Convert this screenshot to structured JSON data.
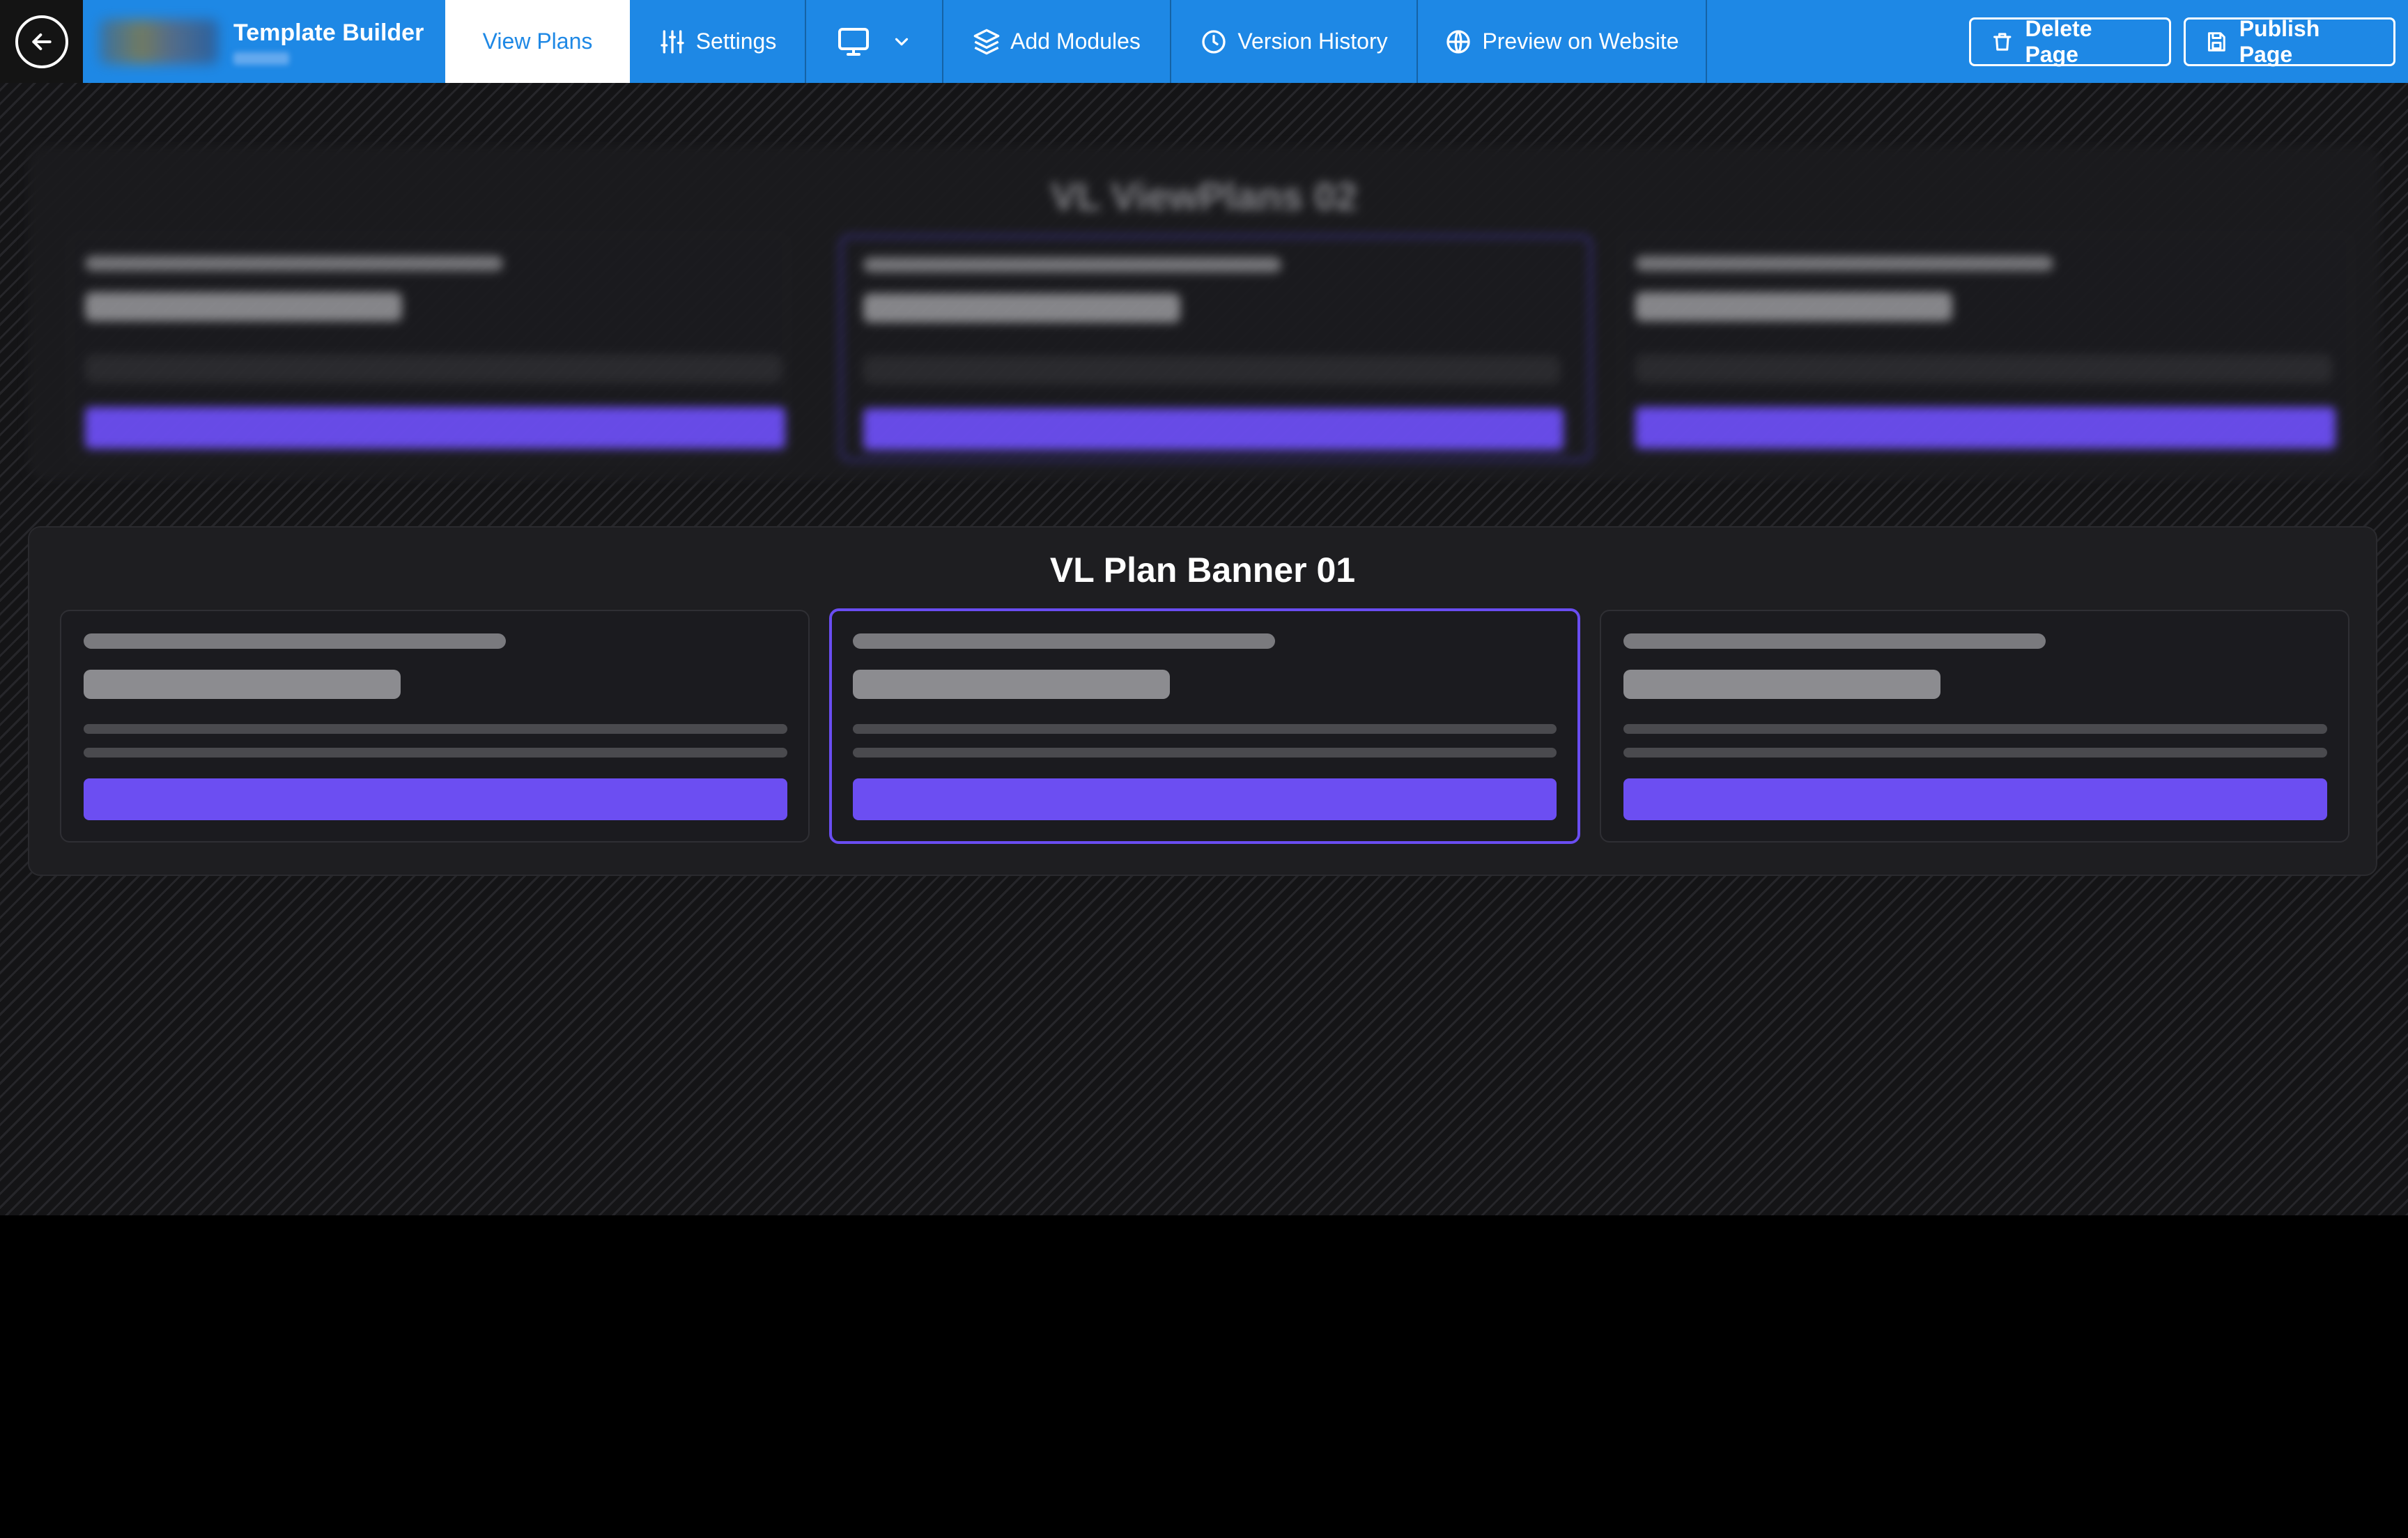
{
  "header": {
    "app_title": "Template Builder",
    "tabs": [
      {
        "label": "View Plans",
        "icon": "eye-icon",
        "active": true
      },
      {
        "label": "Settings",
        "icon": "sliders-icon"
      },
      {
        "label": "",
        "icon": "monitor-icon"
      },
      {
        "label": "Add Modules",
        "icon": "layers-icon"
      },
      {
        "label": "Version History",
        "icon": "clock-icon"
      },
      {
        "label": "Preview on Website",
        "icon": "globe-icon"
      }
    ],
    "actions": {
      "delete_label": "Delete Page",
      "publish_label": "Publish Page"
    }
  },
  "canvas": {
    "sections": [
      {
        "title": "VL ViewPlans 02",
        "blurred": true
      },
      {
        "title": "VL Plan Banner 01",
        "blurred": false
      }
    ]
  },
  "colors": {
    "accent": "#1e88e5",
    "button": "#6c4ef2",
    "selected_border": "#6a4df2"
  }
}
